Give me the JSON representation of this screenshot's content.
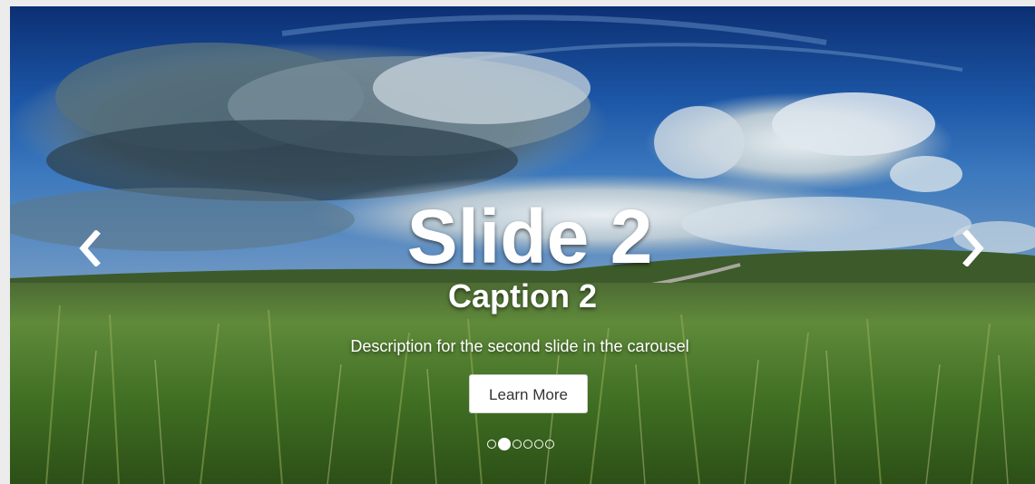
{
  "carousel": {
    "slide": {
      "title": "Slide 2",
      "caption": "Caption 2",
      "description": "Description for the second slide in the carousel",
      "button_label": "Learn More"
    },
    "controls": {
      "prev_icon": "chevron-left-icon",
      "next_icon": "chevron-right-icon"
    },
    "indicators": {
      "count": 6,
      "active_index": 1
    }
  },
  "colors": {
    "text": "#ffffff",
    "button_bg": "#ffffff",
    "button_text": "#333333",
    "sky": "#1f4f9a",
    "grass": "#4a7a2a"
  }
}
